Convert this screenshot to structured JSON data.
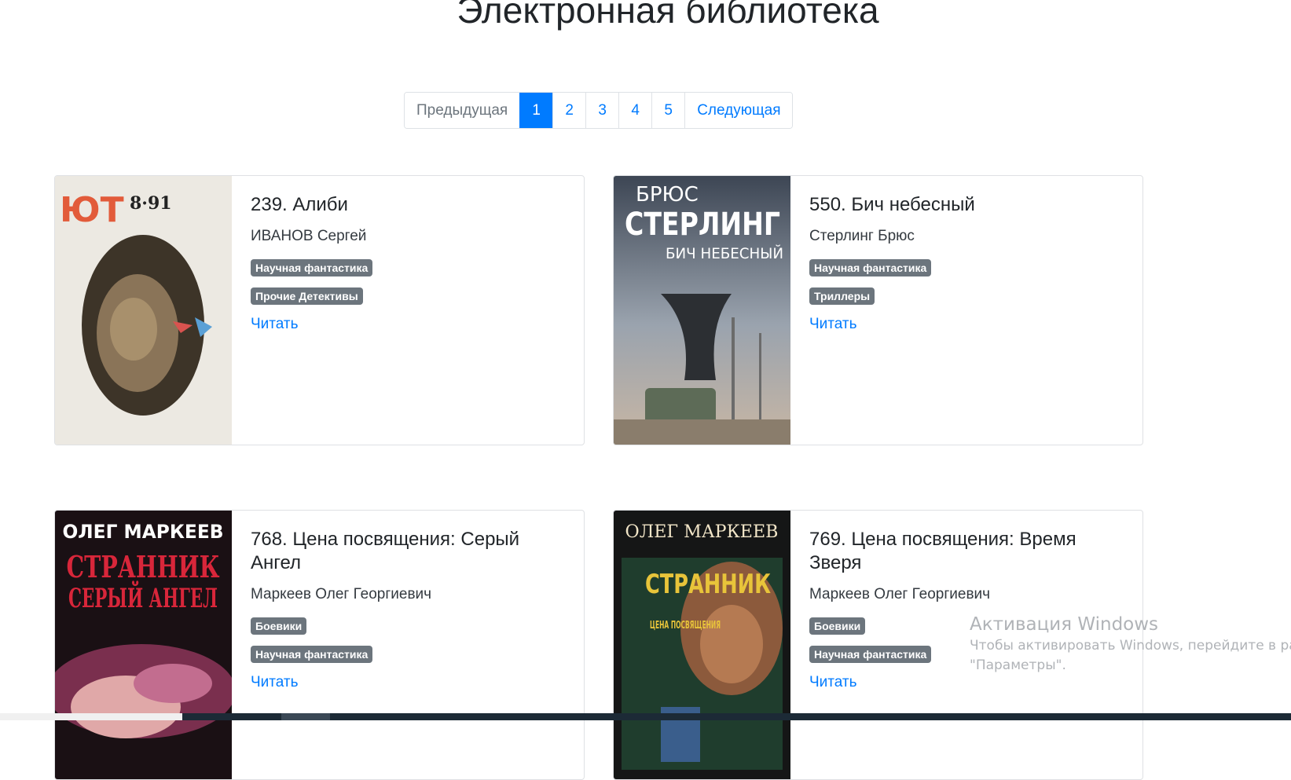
{
  "page": {
    "title": "Электронная библиотека"
  },
  "pagination": {
    "prev": "Предыдущая",
    "pages": [
      "1",
      "2",
      "3",
      "4",
      "5"
    ],
    "active": "1",
    "next": "Следующая"
  },
  "books": [
    {
      "title": "239. Алиби",
      "author": "ИВАНОВ Сергей",
      "tags": [
        "Научная фантастика",
        "Прочие Детективы"
      ],
      "read": "Читать",
      "cover_text": [
        "ЮТ",
        "8·91"
      ]
    },
    {
      "title": "550. Бич небесный",
      "author": "Стерлинг Брюс",
      "tags": [
        "Научная фантастика",
        "Триллеры"
      ],
      "read": "Читать",
      "cover_text": [
        "БРЮС",
        "СТЕРЛИНГ",
        "БИЧ НЕБЕСНЫЙ"
      ]
    },
    {
      "title": "768. Цена посвящения: Серый Ангел",
      "author": "Маркеев Олег Георгиевич",
      "tags": [
        "Боевики",
        "Научная фантастика"
      ],
      "read": "Читать",
      "cover_text": [
        "ОЛЕГ МАРКЕЕВ",
        "СТРАННИК",
        "СЕРЫЙ АНГЕЛ"
      ]
    },
    {
      "title": "769. Цена посвящения: Время Зверя",
      "author": "Маркеев Олег Георгиевич",
      "tags": [
        "Боевики",
        "Научная фантастика"
      ],
      "read": "Читать",
      "cover_text": [
        "ОЛЕГ МАРКЕЕВ",
        "СТРАННИК",
        "ЦЕНА ПОСВЯЩЕНИЯ"
      ]
    }
  ],
  "watermark": {
    "line1": "Активация Windows",
    "line2": "Чтобы активировать Windows, перейдите в разде",
    "line3": "\"Параметры\"."
  },
  "colors": {
    "primary": "#007bff",
    "badge": "#6c757d"
  }
}
